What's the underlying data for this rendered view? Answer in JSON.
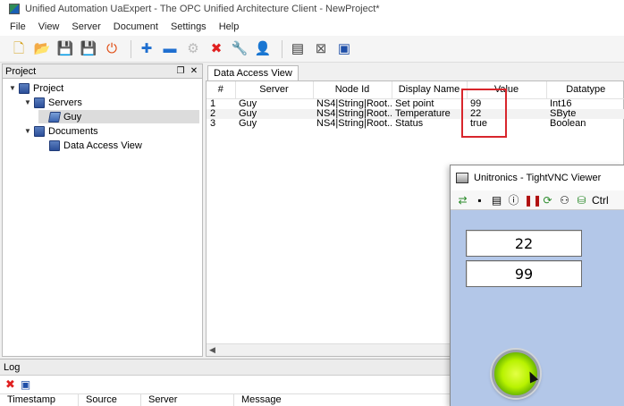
{
  "window": {
    "title": "Unified Automation UaExpert - The OPC Unified Architecture Client - NewProject*"
  },
  "menu": [
    "File",
    "View",
    "Server",
    "Document",
    "Settings",
    "Help"
  ],
  "toolbar_icons": [
    {
      "name": "new-project-icon",
      "glyph": "🗋",
      "color": "#d4a018"
    },
    {
      "name": "open-project-icon",
      "glyph": "📂",
      "color": "#d4a018"
    },
    {
      "name": "save-project-icon",
      "glyph": "💾",
      "color": "#1f4fa8"
    },
    {
      "name": "save-as-icon",
      "glyph": "💾",
      "color": "#1f4fa8"
    },
    {
      "name": "disconnect-power-icon",
      "glyph": "⏻",
      "color": "#e04a10"
    },
    {
      "name": "add-server-icon",
      "glyph": "✚",
      "color": "#1f6fd0"
    },
    {
      "name": "remove-server-icon",
      "glyph": "▬",
      "color": "#1f6fd0"
    },
    {
      "name": "connect-icon",
      "glyph": "⚙",
      "color": "#bbbbbb"
    },
    {
      "name": "delete-icon",
      "glyph": "✖",
      "color": "#e02020"
    },
    {
      "name": "settings-wrench-icon",
      "glyph": "🔧",
      "color": "#c98a10"
    },
    {
      "name": "user-icon",
      "glyph": "👤",
      "color": "#c98a10"
    },
    {
      "name": "document-icon",
      "glyph": "▤",
      "color": "#333333"
    },
    {
      "name": "close-document-icon",
      "glyph": "⊠",
      "color": "#555555"
    },
    {
      "name": "window-icon",
      "glyph": "▣",
      "color": "#1f4fa8"
    }
  ],
  "project_panel": {
    "title": "Project",
    "tree": [
      {
        "label": "Project",
        "level": 0,
        "expanded": true
      },
      {
        "label": "Servers",
        "level": 1,
        "expanded": true
      },
      {
        "label": "Guy",
        "level": 2,
        "selected": true
      },
      {
        "label": "Documents",
        "level": 1,
        "expanded": true
      },
      {
        "label": "Data Access View",
        "level": 2
      }
    ]
  },
  "document_tab": "Data Access View",
  "table": {
    "columns": [
      "#",
      "Server",
      "Node Id",
      "Display Name",
      "Value",
      "Datatype"
    ],
    "rows": [
      {
        "num": "1",
        "server": "Guy",
        "node_id": "NS4|String|Root...",
        "display_name": "Set point",
        "value": "99",
        "datatype": "Int16"
      },
      {
        "num": "2",
        "server": "Guy",
        "node_id": "NS4|String|Root...",
        "display_name": "Temperature",
        "value": "22",
        "datatype": "SByte"
      },
      {
        "num": "3",
        "server": "Guy",
        "node_id": "NS4|String|Root...",
        "display_name": "Status",
        "value": "true",
        "datatype": "Boolean"
      }
    ]
  },
  "log_panel": {
    "title": "Log",
    "columns": [
      "Timestamp",
      "Source",
      "Server",
      "Message"
    ]
  },
  "vnc": {
    "title": "Unitronics - TightVNC Viewer",
    "toolbar_icons": [
      "connection-icon",
      "save-icon",
      "options-icon",
      "info-icon",
      "pause-icon",
      "refresh-icon",
      "transfer-icon",
      "ctrl-icon"
    ],
    "toolbar_text": "Ctrl",
    "display_values": [
      "22",
      "99"
    ],
    "indicator_color": "#b8f200"
  }
}
